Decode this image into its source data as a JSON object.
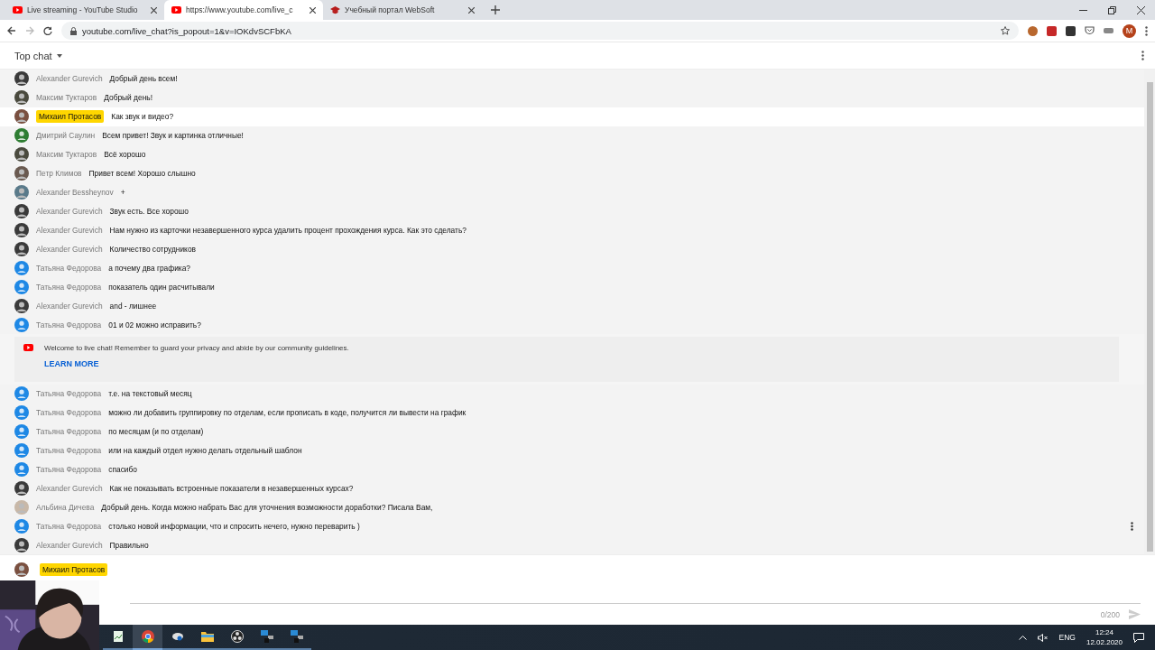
{
  "browser": {
    "tabs": [
      {
        "title": "Live streaming - YouTube Studio",
        "kind": "youtube",
        "selected": false
      },
      {
        "title": "https://www.youtube.com/live_c",
        "kind": "youtube",
        "selected": true
      },
      {
        "title": "Учебный портал WebSoft",
        "kind": "cap",
        "selected": false
      }
    ],
    "url": "youtube.com/live_chat?is_popout=1&v=IOKdvSCFbKA",
    "profile": "M"
  },
  "chat": {
    "header": "Top chat",
    "messages": [
      {
        "author": "Alexander Gurevich",
        "text": "Добрый день всем!",
        "owner": false,
        "highlighted": false
      },
      {
        "author": "Максим Туктаров",
        "text": "Добрый день!",
        "owner": false,
        "highlighted": false
      },
      {
        "author": "Михаил Протасов",
        "text": "Как звук и видео?",
        "owner": true,
        "highlighted": true
      },
      {
        "author": "Дмитрий Саулин",
        "text": "Всем привет! Звук и картинка отличные!",
        "avatar": {
          "kind": "default",
          "color": "#2e7d32"
        },
        "owner": false,
        "highlighted": false
      },
      {
        "author": "Максим Туктаров",
        "text": "Всё хорошо",
        "owner": false,
        "highlighted": false
      },
      {
        "author": "Петр Климов",
        "text": "Привет всем! Хорошо слышно",
        "owner": false,
        "highlighted": false
      },
      {
        "author": "Alexander Bessheynov",
        "text": "+",
        "owner": false,
        "highlighted": false
      },
      {
        "author": "Alexander Gurevich",
        "text": "Звук есть. Все хорошо",
        "owner": false,
        "highlighted": false
      },
      {
        "author": "Alexander Gurevich",
        "text": "Нам нужно из карточки незавершенного курса удалить процент прохождения курса. Как это сделать?",
        "owner": false,
        "highlighted": false
      },
      {
        "author": "Alexander Gurevich",
        "text": "Количество сотрудников",
        "owner": false,
        "highlighted": false
      },
      {
        "author": "Татьяна Федорова",
        "text": "а почему два графика?",
        "avatar": {
          "kind": "default",
          "color": "#1e88e5"
        },
        "owner": false,
        "highlighted": false
      },
      {
        "author": "Татьяна Федорова",
        "text": "показатель один расчитывали",
        "avatar": {
          "kind": "default",
          "color": "#1e88e5"
        },
        "owner": false,
        "highlighted": false
      },
      {
        "author": "Alexander Gurevich",
        "text": "and - лишнее",
        "owner": false,
        "highlighted": false
      },
      {
        "author": "Татьяна Федорова",
        "text": "01 и 02 можно исправить?",
        "avatar": {
          "kind": "default",
          "color": "#1e88e5"
        },
        "owner": false,
        "highlighted": false
      },
      {
        "kind": "banner",
        "text": "Welcome to live chat! Remember to guard your privacy and abide by our community guidelines.",
        "link": "LEARN MORE"
      },
      {
        "author": "Татьяна Федорова",
        "text": "т.е. на текстовый месяц",
        "avatar": {
          "kind": "default",
          "color": "#1e88e5"
        },
        "owner": false,
        "highlighted": false
      },
      {
        "author": "Татьяна Федорова",
        "text": "можно ли добавить группировку по отделам, если прописать в коде, получится ли вывести на график",
        "avatar": {
          "kind": "default",
          "color": "#1e88e5"
        },
        "owner": false,
        "highlighted": false
      },
      {
        "author": "Татьяна Федорова",
        "text": "по месяцам (и по отделам)",
        "avatar": {
          "kind": "default",
          "color": "#1e88e5"
        },
        "owner": false,
        "highlighted": false
      },
      {
        "author": "Татьяна Федорова",
        "text": "или на каждый отдел нужно делать отдельный шаблон",
        "avatar": {
          "kind": "default",
          "color": "#1e88e5"
        },
        "owner": false,
        "highlighted": false
      },
      {
        "author": "Татьяна Федорова",
        "text": "спасибо",
        "avatar": {
          "kind": "default",
          "color": "#1e88e5"
        },
        "owner": false,
        "highlighted": false
      },
      {
        "author": "Alexander Gurevich",
        "text": "Как не показывать встроенные показатели в незавершенных курсах?",
        "owner": false,
        "highlighted": false
      },
      {
        "author": "Альбина Дичева",
        "text": "Добрый день. Когда можно набрать Вас для уточнения возможности доработки? Писала Вам,",
        "owner": false,
        "highlighted": false
      },
      {
        "author": "Татьяна Федорова",
        "text": "столько новой информации, что и спросить нечего, нужно переварить )",
        "avatar": {
          "kind": "default",
          "color": "#1e88e5"
        },
        "owner": false,
        "highlighted": false
      },
      {
        "author": "Alexander Gurevich",
        "text": "Правильно",
        "owner": false,
        "highlighted": false
      }
    ],
    "composer": {
      "author": "Михаил Протасов",
      "counter": "0/200"
    }
  },
  "taskbar": {
    "apps": [
      {
        "kind": "sheet",
        "selected": false
      },
      {
        "kind": "chrome",
        "selected": true
      },
      {
        "kind": "tool",
        "selected": false
      },
      {
        "kind": "folder",
        "selected": false
      },
      {
        "kind": "obs",
        "selected": false
      },
      {
        "kind": "blocks",
        "selected": false
      },
      {
        "kind": "blocks",
        "selected": false
      }
    ],
    "language": "ENG",
    "time": "12:24",
    "date": "12.02.2020"
  }
}
